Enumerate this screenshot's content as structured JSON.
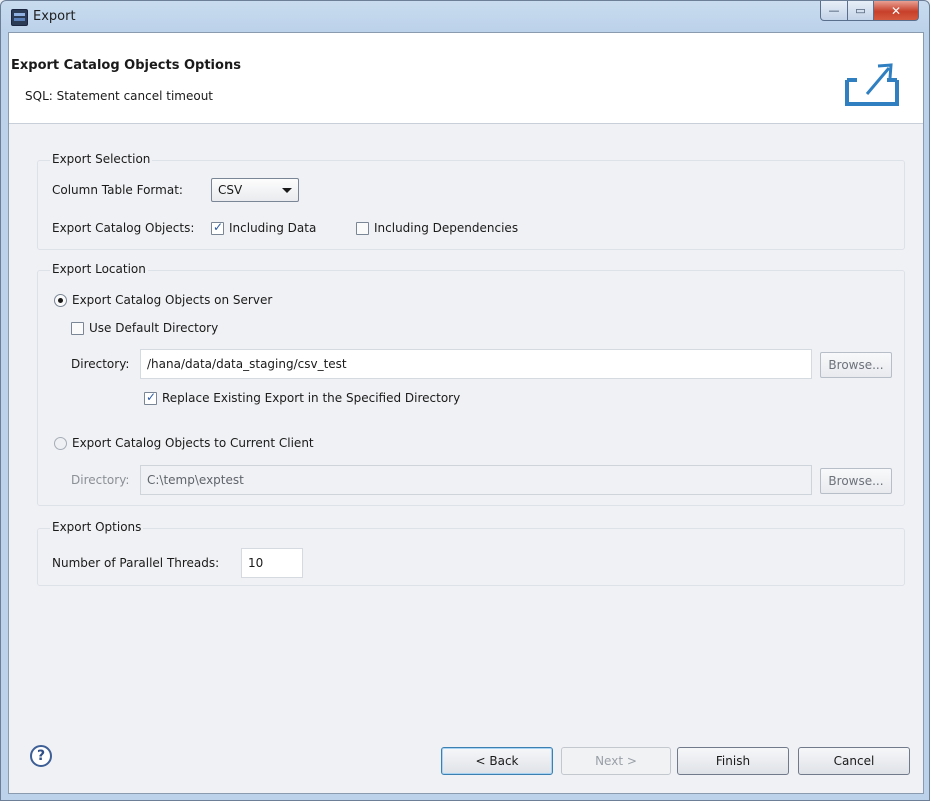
{
  "window": {
    "title": "Export",
    "controls": {
      "minimize": "—",
      "maximize": "▭",
      "close": "✕"
    }
  },
  "header": {
    "title": "Export Catalog Objects Options",
    "message": "SQL: Statement cancel timeout",
    "icon": "export-icon"
  },
  "export_selection": {
    "group_title": "Export Selection",
    "column_format_label": "Column Table Format:",
    "column_format_value": "CSV",
    "catalog_objects_label": "Export Catalog Objects:",
    "including_data_label": "Including Data",
    "including_data_checked": true,
    "including_dependencies_label": "Including Dependencies",
    "including_dependencies_checked": false
  },
  "export_location": {
    "group_title": "Export Location",
    "server_option_label": "Export Catalog Objects on Server",
    "server_option_selected": true,
    "use_default_dir_label": "Use Default Directory",
    "use_default_dir_checked": false,
    "server_directory_label": "Directory:",
    "server_directory_value": "/hana/data/data_staging/csv_test",
    "server_browse_label": "Browse...",
    "replace_existing_label": "Replace Existing Export in the Specified Directory",
    "replace_existing_checked": true,
    "client_option_label": "Export Catalog Objects to Current Client",
    "client_option_selected": false,
    "client_directory_label": "Directory:",
    "client_directory_value": "C:\\temp\\exptest",
    "client_browse_label": "Browse..."
  },
  "export_options": {
    "group_title": "Export Options",
    "threads_label": "Number of Parallel Threads:",
    "threads_value": "10"
  },
  "footer": {
    "help_label": "?",
    "back_label": "< Back",
    "next_label": "Next >",
    "finish_label": "Finish",
    "cancel_label": "Cancel"
  }
}
